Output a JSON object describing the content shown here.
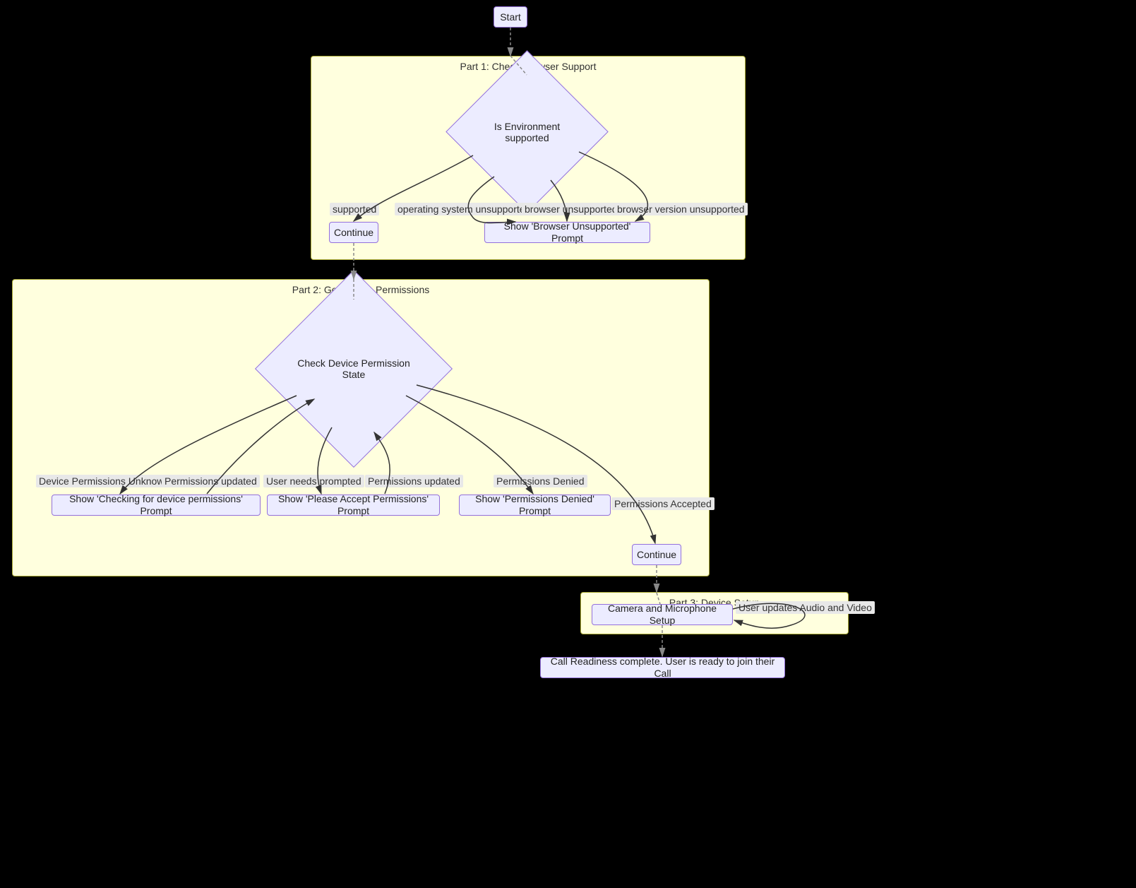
{
  "nodes": {
    "start": "Start",
    "env_supported": "Is Environment supported",
    "continue1": "Continue",
    "browser_unsupported_prompt": "Show 'Browser Unsupported' Prompt",
    "check_device_perm": "Check Device Permission State",
    "checking_perms_prompt": "Show 'Checking for device permissions' Prompt",
    "accept_perms_prompt": "Show 'Please Accept Permissions' Prompt",
    "denied_prompt": "Show 'Permissions Denied' Prompt",
    "continue2": "Continue",
    "camera_mic_setup": "Camera and Microphone Setup",
    "final": "Call Readiness complete. User is ready to join their Call"
  },
  "subgraphs": {
    "part1": "Part 1: Check Browser Support",
    "part2": "Part 2: Get Device Permissions",
    "part3": "Part 3: Device Setup"
  },
  "edges": {
    "supported": "supported",
    "os_unsupported": "operating system unsupported",
    "browser_unsupported": "browser unsupported",
    "browser_version_unsupported": "browser version unsupported",
    "perms_unknown": "Device Permissions Unknown",
    "perms_updated1": "Permissions updated",
    "needs_prompted": "User needs prompted",
    "perms_updated2": "Permissions updated",
    "perms_denied": "Permissions Denied",
    "perms_accepted": "Permissions Accepted",
    "user_updates_av": "User updates Audio and Video"
  }
}
